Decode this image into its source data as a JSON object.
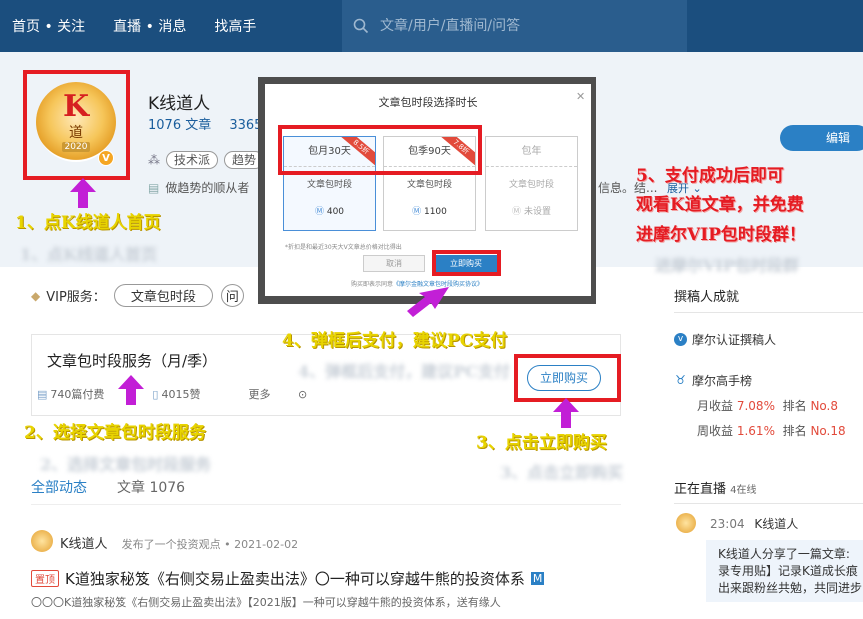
{
  "topnav": {
    "items": [
      "首页 • 关注",
      "直播 • 消息",
      "找高手"
    ],
    "search_placeholder": "文章/用户/直播间/问答"
  },
  "profile": {
    "name": "K线道人",
    "articles": "1076 文章",
    "followers_partial": "3365",
    "tag_1": "技术派",
    "tag_2": "趋势",
    "bio": "做趋势的顺从者",
    "bio_more": "信息。结...",
    "expand": "展开",
    "edit_label": "编辑",
    "avatar_letter": "K",
    "avatar_char": "道",
    "avatar_year": "2020",
    "v_badge": "V"
  },
  "modal": {
    "title": "文章包时段选择时长",
    "plans": [
      {
        "name": "包月30天",
        "sub": "文章包时段",
        "price": "400",
        "discount": "8.5折"
      },
      {
        "name": "包季90天",
        "sub": "文章包时段",
        "price": "1100",
        "discount": "7.8折"
      },
      {
        "name": "包年",
        "sub": "文章包时段",
        "price": "未设置",
        "discount": ""
      }
    ],
    "note": "*折扣是和最近30天大V文章总价格对比得出",
    "cancel": "取消",
    "buy": "立即购买",
    "agree_prefix": "购买即表示同意",
    "agree_link": "《摩尔金融文章包时段购买协议》"
  },
  "annotations": {
    "step1": "1、点K线道人首页",
    "step2": "2、选择文章包时段服务",
    "step3": "3、点击立即购买",
    "step4": "4、弹框后支付，建议PC支付",
    "step5_line1": "5、支付成功后即可",
    "step5_line2": "观看K道文章，并免费",
    "step5_line3": "进摩尔VIP包时段群！"
  },
  "vip": {
    "label": "VIP服务：",
    "pill_1": "文章包时段",
    "pill_2": "问"
  },
  "service": {
    "title": "文章包时段服务（月/季）",
    "meta_1": "740篇付费",
    "meta_2": "4015赞",
    "meta_more": "更多",
    "buy": "立即购买"
  },
  "tabs": {
    "all": "全部动态",
    "articles": "文章 1076"
  },
  "feed": {
    "author": "K线道人",
    "action": "发布了一个投资观点 • 2021-02-02",
    "pin": "置顶",
    "title": "K道独家秘笈《右侧交易止盈卖出法》〇一种可以穿越牛熊的投资体系",
    "badge": "M",
    "summary": "〇〇〇K道独家秘笈《右侧交易止盈卖出法》【2021版】一种可以穿越牛熊的投资体系，送有缘人"
  },
  "sidebar": {
    "title": "撰稿人成就",
    "ach_1": "摩尔认证撰稿人",
    "ach_2": "摩尔高手榜",
    "monthly_label": "月收益",
    "monthly_value": "7.08%",
    "monthly_rank_label": "排名",
    "monthly_rank": "No.8",
    "weekly_label": "周收益",
    "weekly_value": "1.61%",
    "weekly_rank_label": "排名",
    "weekly_rank": "No.18",
    "live_title": "正在直播",
    "live_count": "4在线",
    "live_time": "23:04",
    "live_name": "K线道人",
    "live_text_1": "K线道人分享了一篇文章:",
    "live_text_2": "录专用贴】记录K道成长痕",
    "live_text_3": "出来跟粉丝共勉，共同进步"
  }
}
